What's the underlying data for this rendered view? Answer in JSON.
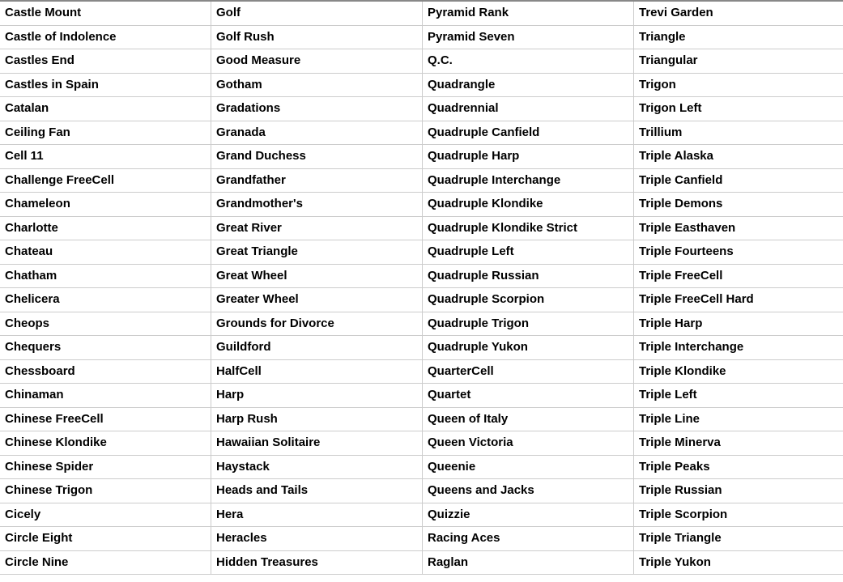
{
  "table": {
    "columns": [
      "col-0",
      "col-1",
      "col-2",
      "col-3"
    ],
    "rows": [
      [
        "Castle Mount",
        "Golf",
        "Pyramid Rank",
        "Trevi Garden"
      ],
      [
        "Castle of Indolence",
        "Golf Rush",
        "Pyramid Seven",
        "Triangle"
      ],
      [
        "Castles End",
        "Good Measure",
        "Q.C.",
        "Triangular"
      ],
      [
        "Castles in Spain",
        "Gotham",
        "Quadrangle",
        "Trigon"
      ],
      [
        "Catalan",
        "Gradations",
        "Quadrennial",
        "Trigon Left"
      ],
      [
        "Ceiling Fan",
        "Granada",
        "Quadruple Canfield",
        "Trillium"
      ],
      [
        "Cell 11",
        "Grand Duchess",
        "Quadruple Harp",
        "Triple Alaska"
      ],
      [
        "Challenge FreeCell",
        "Grandfather",
        "Quadruple Interchange",
        "Triple Canfield"
      ],
      [
        "Chameleon",
        "Grandmother's",
        "Quadruple Klondike",
        "Triple Demons"
      ],
      [
        "Charlotte",
        "Great River",
        "Quadruple Klondike Strict",
        "Triple Easthaven"
      ],
      [
        "Chateau",
        "Great Triangle",
        "Quadruple Left",
        "Triple Fourteens"
      ],
      [
        "Chatham",
        "Great Wheel",
        "Quadruple Russian",
        "Triple FreeCell"
      ],
      [
        "Chelicera",
        "Greater Wheel",
        "Quadruple Scorpion",
        "Triple FreeCell Hard"
      ],
      [
        "Cheops",
        "Grounds for Divorce",
        "Quadruple Trigon",
        "Triple Harp"
      ],
      [
        "Chequers",
        "Guildford",
        "Quadruple Yukon",
        "Triple Interchange"
      ],
      [
        "Chessboard",
        "HalfCell",
        "QuarterCell",
        "Triple Klondike"
      ],
      [
        "Chinaman",
        "Harp",
        "Quartet",
        "Triple Left"
      ],
      [
        "Chinese FreeCell",
        "Harp Rush",
        "Queen of Italy",
        "Triple Line"
      ],
      [
        "Chinese Klondike",
        "Hawaiian Solitaire",
        "Queen Victoria",
        "Triple Minerva"
      ],
      [
        "Chinese Spider",
        "Haystack",
        "Queenie",
        "Triple Peaks"
      ],
      [
        "Chinese Trigon",
        "Heads and Tails",
        "Queens and Jacks",
        "Triple Russian"
      ],
      [
        "Cicely",
        "Hera",
        "Quizzie",
        "Triple Scorpion"
      ],
      [
        "Circle Eight",
        "Heracles",
        "Racing Aces",
        "Triple Triangle"
      ],
      [
        "Circle Nine",
        "Hidden Treasures",
        "Raglan",
        "Triple Yukon"
      ]
    ]
  }
}
